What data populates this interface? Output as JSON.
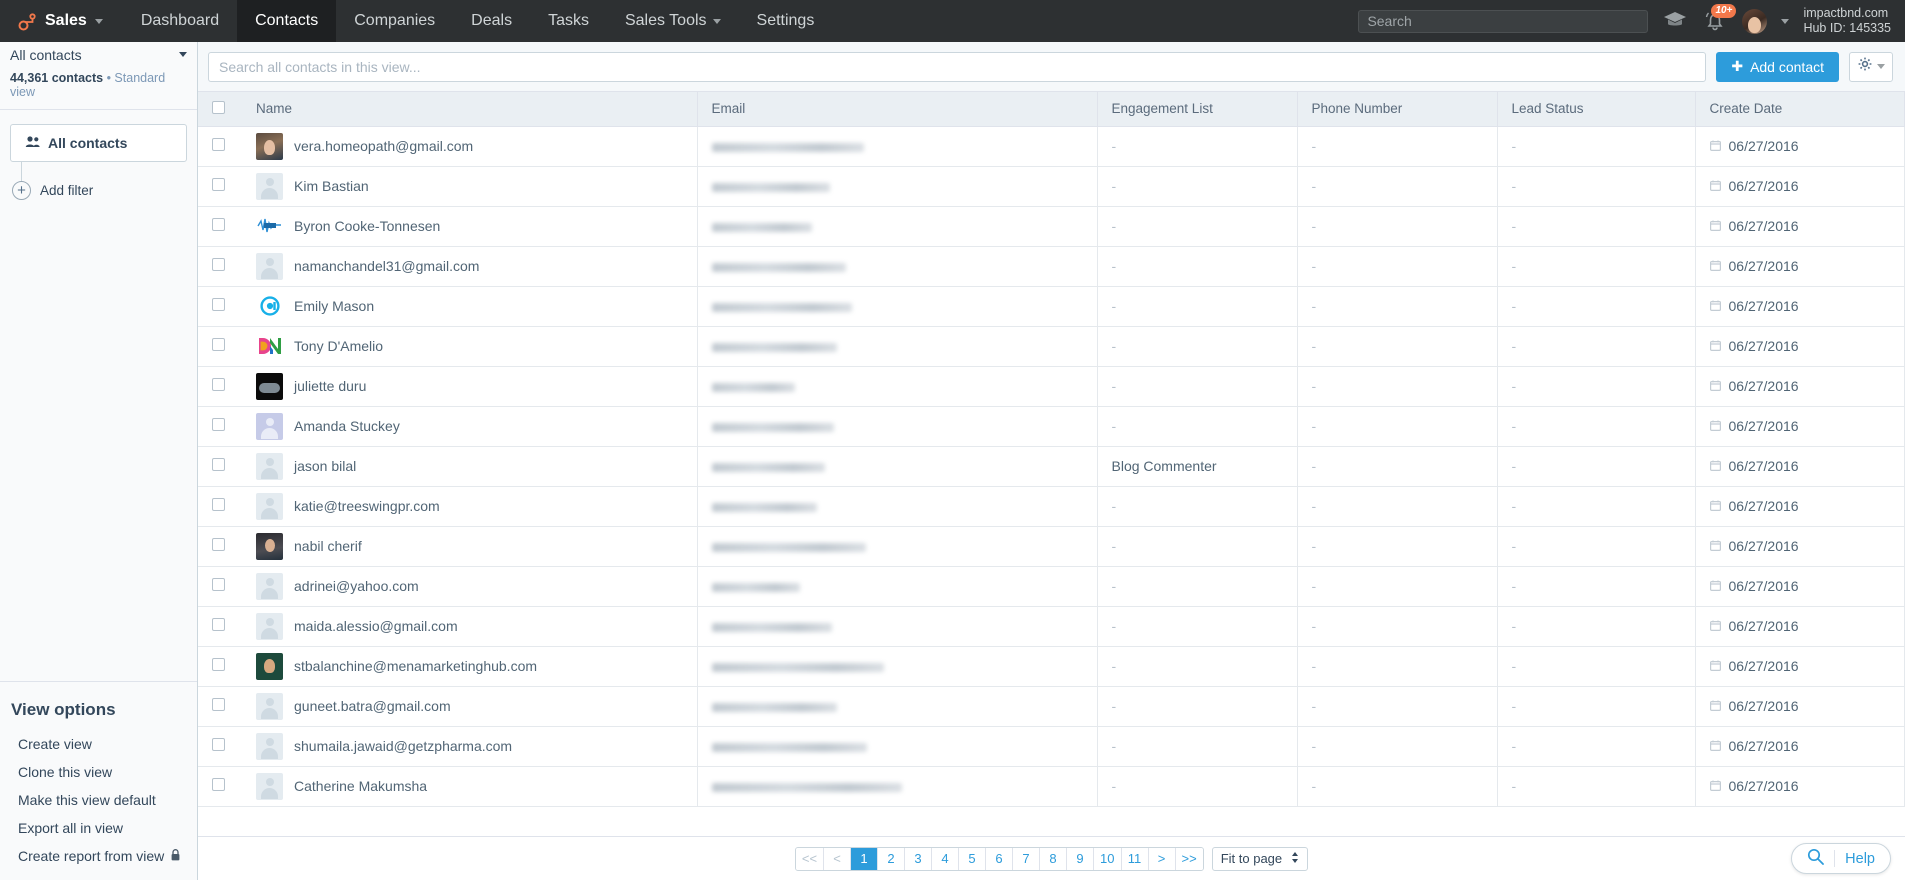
{
  "topnav": {
    "brand": "Sales",
    "items": [
      {
        "label": "Dashboard",
        "active": false,
        "caret": false
      },
      {
        "label": "Contacts",
        "active": true,
        "caret": false
      },
      {
        "label": "Companies",
        "active": false,
        "caret": false
      },
      {
        "label": "Deals",
        "active": false,
        "caret": false
      },
      {
        "label": "Tasks",
        "active": false,
        "caret": false
      },
      {
        "label": "Sales Tools",
        "active": false,
        "caret": true
      },
      {
        "label": "Settings",
        "active": false,
        "caret": false
      }
    ],
    "search_placeholder": "Search",
    "notifications_badge": "10+",
    "account_name": "impactbnd.com",
    "hub_id": "Hub ID: 145335"
  },
  "sidebar": {
    "view_selector": "All contacts",
    "count_bold": "44,361 contacts",
    "count_rest": " • Standard view",
    "filter_card": "All contacts",
    "add_filter": "Add filter",
    "view_options_title": "View options",
    "view_options": [
      {
        "label": "Create view",
        "locked": false
      },
      {
        "label": "Clone this view",
        "locked": false
      },
      {
        "label": "Make this view default",
        "locked": false
      },
      {
        "label": "Export all in view",
        "locked": false
      },
      {
        "label": "Create report from view",
        "locked": true
      }
    ]
  },
  "toolbar": {
    "search_placeholder": "Search all contacts in this view...",
    "add_contact_label": "Add contact",
    "add_contact_color": "#2d9cdb"
  },
  "table": {
    "columns": [
      "Name",
      "Email",
      "Engagement List",
      "Phone Number",
      "Lead Status",
      "Create Date"
    ],
    "rows": [
      {
        "name": "vera.homeopath@gmail.com",
        "avatar": "photo1",
        "email_width": 152,
        "engagement": "-",
        "phone": "-",
        "lead_status": "-",
        "create_date": "06/27/2016"
      },
      {
        "name": "Kim Bastian",
        "avatar": "placeholder",
        "email_width": 118,
        "engagement": "-",
        "phone": "-",
        "lead_status": "-",
        "create_date": "06/27/2016"
      },
      {
        "name": "Byron Cooke-Tonnesen",
        "avatar": "logo-bullhorn",
        "email_width": 100,
        "engagement": "-",
        "phone": "-",
        "lead_status": "-",
        "create_date": "06/27/2016"
      },
      {
        "name": "namanchandel31@gmail.com",
        "avatar": "placeholder",
        "email_width": 134,
        "engagement": "-",
        "phone": "-",
        "lead_status": "-",
        "create_date": "06/27/2016"
      },
      {
        "name": "Emily Mason",
        "avatar": "logo-c",
        "email_width": 140,
        "engagement": "-",
        "phone": "-",
        "lead_status": "-",
        "create_date": "06/27/2016"
      },
      {
        "name": "Tony D'Amelio",
        "avatar": "logo-dn",
        "email_width": 125,
        "engagement": "-",
        "phone": "-",
        "lead_status": "-",
        "create_date": "06/27/2016"
      },
      {
        "name": "juliette duru",
        "avatar": "photo2",
        "email_width": 83,
        "engagement": "-",
        "phone": "-",
        "lead_status": "-",
        "create_date": "06/27/2016"
      },
      {
        "name": "Amanda Stuckey",
        "avatar": "placeholder-lav",
        "email_width": 122,
        "engagement": "-",
        "phone": "-",
        "lead_status": "-",
        "create_date": "06/27/2016"
      },
      {
        "name": "jason bilal",
        "avatar": "placeholder",
        "email_width": 113,
        "engagement": "Blog Commenter",
        "phone": "-",
        "lead_status": "-",
        "create_date": "06/27/2016"
      },
      {
        "name": "katie@treeswingpr.com",
        "avatar": "placeholder",
        "email_width": 105,
        "engagement": "-",
        "phone": "-",
        "lead_status": "-",
        "create_date": "06/27/2016"
      },
      {
        "name": "nabil cherif",
        "avatar": "photo3",
        "email_width": 154,
        "engagement": "-",
        "phone": "-",
        "lead_status": "-",
        "create_date": "06/27/2016"
      },
      {
        "name": "adrinei@yahoo.com",
        "avatar": "placeholder",
        "email_width": 88,
        "engagement": "-",
        "phone": "-",
        "lead_status": "-",
        "create_date": "06/27/2016"
      },
      {
        "name": "maida.alessio@gmail.com",
        "avatar": "placeholder",
        "email_width": 120,
        "engagement": "-",
        "phone": "-",
        "lead_status": "-",
        "create_date": "06/27/2016"
      },
      {
        "name": "stbalanchine@menamarketinghub.com",
        "avatar": "photo4",
        "email_width": 172,
        "engagement": "-",
        "phone": "-",
        "lead_status": "-",
        "create_date": "06/27/2016"
      },
      {
        "name": "guneet.batra@gmail.com",
        "avatar": "placeholder",
        "email_width": 125,
        "engagement": "-",
        "phone": "-",
        "lead_status": "-",
        "create_date": "06/27/2016"
      },
      {
        "name": "shumaila.jawaid@getzpharma.com",
        "avatar": "placeholder",
        "email_width": 155,
        "engagement": "-",
        "phone": "-",
        "lead_status": "-",
        "create_date": "06/27/2016"
      },
      {
        "name": "Catherine Makumsha",
        "avatar": "placeholder",
        "email_width": 190,
        "engagement": "-",
        "phone": "-",
        "lead_status": "-",
        "create_date": "06/27/2016"
      }
    ]
  },
  "footer": {
    "pages": [
      "<<",
      "<",
      "1",
      "2",
      "3",
      "4",
      "5",
      "6",
      "7",
      "8",
      "9",
      "10",
      "11",
      ">",
      ">>"
    ],
    "active_page": "1",
    "fit_to_page": "Fit to page",
    "help_label": "Help"
  }
}
